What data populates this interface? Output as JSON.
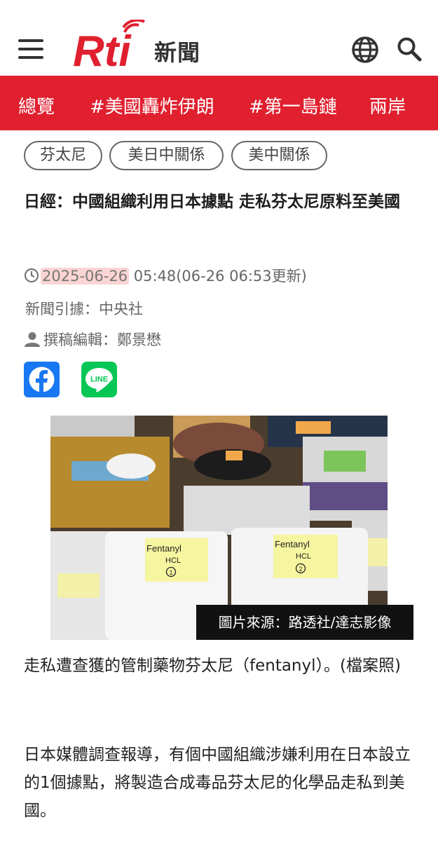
{
  "header": {
    "logo_text": "Rti",
    "logo_sub": "新聞",
    "brand_color": "#e0202f"
  },
  "nav": {
    "items": [
      "總覽",
      "#美國轟炸伊朗",
      "#第一島鏈",
      "兩岸"
    ]
  },
  "tags": [
    "芬太尼",
    "美日中關係",
    "美中關係"
  ],
  "article": {
    "title": "日經：中國組織利用日本據點 走私芬太尼原料至美國",
    "date": "2025-06-26",
    "time_updated": " 05:48(06-26 06:53更新)",
    "source": "新聞引據：中央社",
    "editor": "撰稿編輯：鄭景懋",
    "photo_credit": "圖片來源：路透社/達志影像",
    "photo_labels": [
      "Fentanyl",
      "HCL",
      "1",
      "Fentanyl",
      "HCL",
      "2"
    ],
    "caption": "走私遭查獲的管制藥物芬太尼（fentanyl）。(檔案照)",
    "paragraph": "日本媒體調查報導，有個中國組織涉嫌利用在日本設立的1個據點，將製造合成毒品芬太尼的化學品走私到美國。"
  },
  "social": {
    "facebook_icon": "facebook-icon",
    "line_icon": "line-icon",
    "line_label": "LINE"
  }
}
